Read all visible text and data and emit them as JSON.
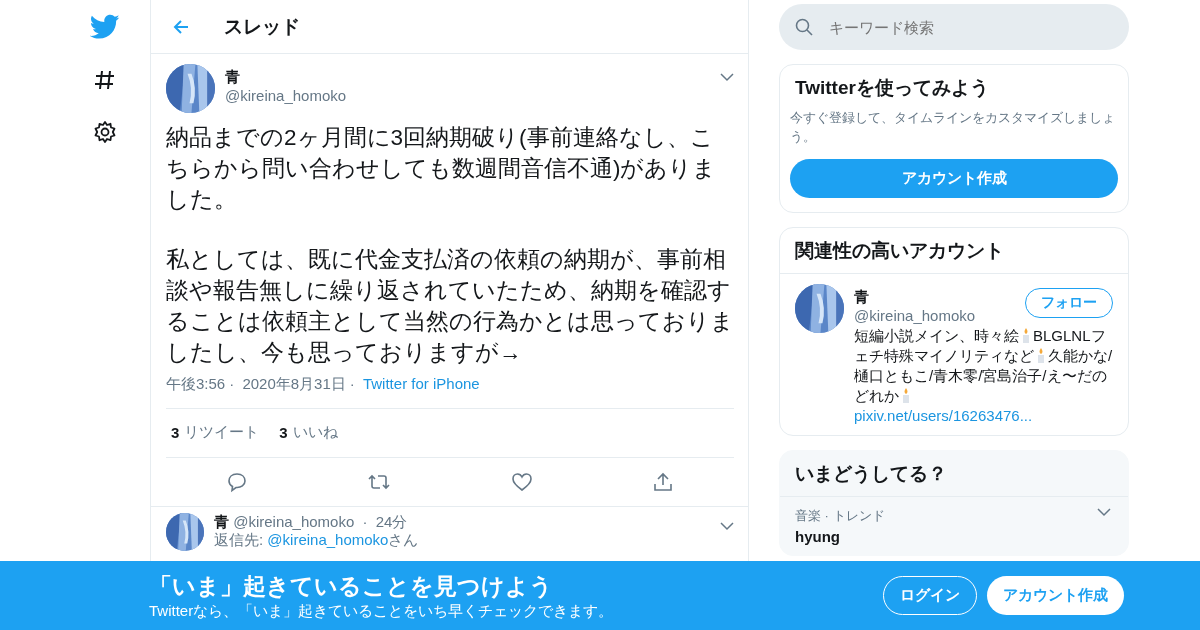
{
  "header": {
    "title": "スレッド"
  },
  "search": {
    "placeholder": "キーワード検索"
  },
  "tweet": {
    "name": "青",
    "handle": "@kireina_homoko",
    "paragraphs": [
      "納品までの2ヶ月間に3回納期破り(事前連絡なし、こちらから問い合わせしても数週間音信不通)がありました。",
      "私としては、既に代金支払済の依頼の納期が、事前相談や報告無しに繰り返されていたため、納期を確認することは依頼主として当然の行為かとは思っておりましたし、今も思っておりますが→"
    ],
    "time": "午後3:56",
    "separator": "·",
    "date": "2020年8月31日",
    "source": "Twitter for iPhone",
    "stats": [
      {
        "count": "3",
        "label": "リツイート"
      },
      {
        "count": "3",
        "label": "いいね"
      }
    ]
  },
  "reply": {
    "name": "青",
    "handle": "@kireina_homoko",
    "separator": "·",
    "age": "24分",
    "reply_to_prefix": "返信先: ",
    "reply_to": "@kireina_homoko",
    "reply_to_suffix": "さん"
  },
  "signup_card": {
    "title": "Twitterを使ってみよう",
    "text": "今すぐ登録して、タイムラインをカスタマイズしましょう。",
    "button": "アカウント作成"
  },
  "related": {
    "title": "関連性の高いアカウント",
    "account": {
      "name": "青",
      "handle": "@kireina_homoko",
      "follow": "フォロー",
      "bio": [
        "短編小説メイン、時々絵",
        "BLGLNLフェチ特殊マイノリティなど",
        "久能かな/樋口ともこ/青木零/宮島治子/え〜だのどれか"
      ],
      "link": "pixiv.net/users/16263476..."
    }
  },
  "trends": {
    "title": "いまどうしてる？",
    "items": [
      {
        "context": "音楽 · トレンド",
        "name": "hyung"
      }
    ]
  },
  "banner": {
    "title": "「いま」起きていることを見つけよう",
    "text": "Twitterなら、「いま」起きていることをいち早くチェックできます。",
    "login": "ログイン",
    "signup": "アカウント作成"
  }
}
